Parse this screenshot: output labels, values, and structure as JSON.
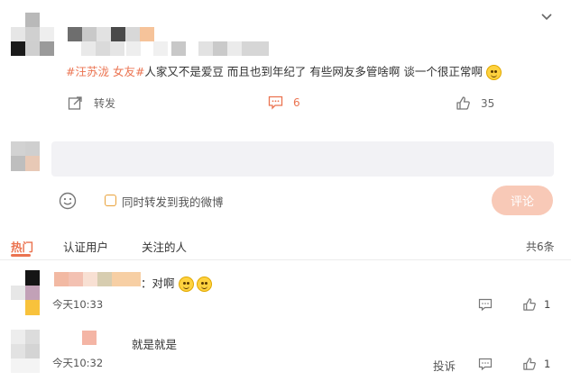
{
  "post": {
    "tag1": "#汪苏泷 女友#",
    "text": "人家又不是爱豆 而且也到年纪了 有些网友多管啥啊 谈一个很正常啊",
    "emoji_icon": "smirk-emoji-icon",
    "repost_label": "转发",
    "comment_count": "6",
    "like_count": "35"
  },
  "composer": {
    "placeholder": "",
    "repost_option_label": "同时转发到我的微博",
    "submit_label": "评论"
  },
  "comments_header": {
    "tabs": [
      "热门",
      "认证用户",
      "关注的人"
    ],
    "total": "共6条"
  },
  "comments": [
    {
      "text": "：对啊",
      "time": "今天10:33",
      "likes": "1"
    },
    {
      "text": "就是就是",
      "time": "今天10:32",
      "likes": "1",
      "report_label": "投诉"
    }
  ],
  "colors": {
    "accent": "#eb7350",
    "submit_bg": "#f8c9b7"
  }
}
